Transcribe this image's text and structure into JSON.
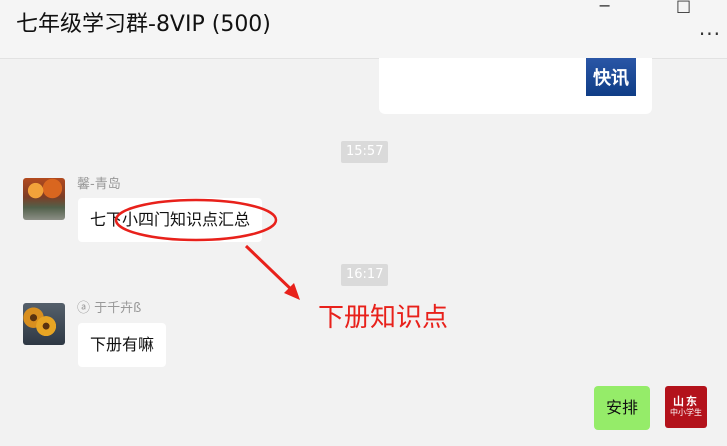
{
  "header": {
    "title": "七年级学习群-8VIP (500)",
    "more_label": "..."
  },
  "shared_card": {
    "thumb_label": "快讯"
  },
  "timestamps": [
    "15:57",
    "16:17"
  ],
  "messages": [
    {
      "sender": "馨-青岛",
      "text": "七下小四门知识点汇总",
      "avatar_icon": "autumn-path-icon"
    },
    {
      "sender": "ⓐ 于千卉ß",
      "text": "下册有嘛",
      "avatar_icon": "sunflower-icon"
    },
    {
      "sender": "",
      "text": "安排",
      "avatar_icon": "news-logo-icon",
      "avatar_line1": "山东",
      "avatar_line2": "中小学生"
    }
  ],
  "annotation": {
    "label": "下册知识点",
    "color": "#e8211b"
  },
  "colors": {
    "background": "#f2f2f2",
    "bubble_mine": "#95ec69",
    "bubble_other": "#ffffff",
    "timestamp_bg": "#dadada"
  }
}
